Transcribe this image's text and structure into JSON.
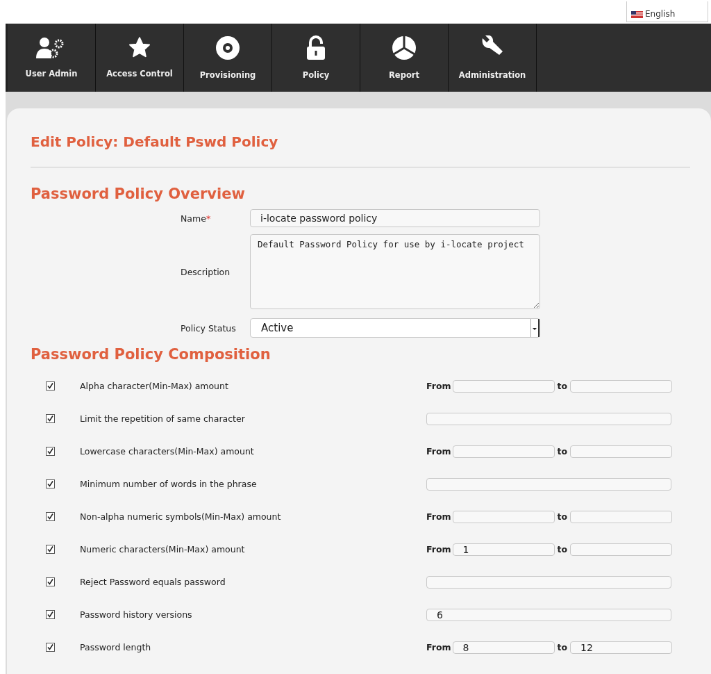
{
  "language": {
    "label": "English"
  },
  "nav": [
    {
      "label": "User Admin"
    },
    {
      "label": "Access Control"
    },
    {
      "label": "Provisioning"
    },
    {
      "label": "Policy"
    },
    {
      "label": "Report"
    },
    {
      "label": "Administration"
    }
  ],
  "page_title": "Edit Policy: Default Pswd Policy",
  "overview": {
    "heading": "Password Policy Overview",
    "name": {
      "label": "Name",
      "required_mark": "*",
      "value": "i-locate password policy"
    },
    "description": {
      "label": "Description",
      "value": "Default Password Policy for use by i-locate project"
    },
    "status": {
      "label": "Policy Status",
      "value": "Active"
    }
  },
  "composition": {
    "heading": "Password Policy Composition",
    "rows": [
      {
        "kind": "range",
        "checked": true,
        "label": "Alpha character(Min-Max) amount",
        "from_label": "From",
        "from": "",
        "to_label": "to",
        "to": ""
      },
      {
        "kind": "single",
        "checked": true,
        "label": "Limit the repetition of same character",
        "value": ""
      },
      {
        "kind": "range",
        "checked": true,
        "label": "Lowercase characters(Min-Max) amount",
        "from_label": "From",
        "from": "",
        "to_label": "to",
        "to": ""
      },
      {
        "kind": "single",
        "checked": true,
        "label": "Minimum number of words in the phrase",
        "value": ""
      },
      {
        "kind": "range",
        "checked": true,
        "label": "Non-alpha numeric symbols(Min-Max) amount",
        "from_label": "From",
        "from": "",
        "to_label": "to",
        "to": ""
      },
      {
        "kind": "range",
        "checked": true,
        "label": "Numeric characters(Min-Max) amount",
        "from_label": "From",
        "from": "1",
        "to_label": "to",
        "to": ""
      },
      {
        "kind": "single",
        "checked": true,
        "label": "Reject Password equals password",
        "value": ""
      },
      {
        "kind": "single",
        "checked": true,
        "label": "Password history versions",
        "value": "6"
      },
      {
        "kind": "range",
        "checked": true,
        "label": "Password length",
        "from_label": "From",
        "from": "8",
        "to_label": "to",
        "to": "12"
      }
    ]
  }
}
